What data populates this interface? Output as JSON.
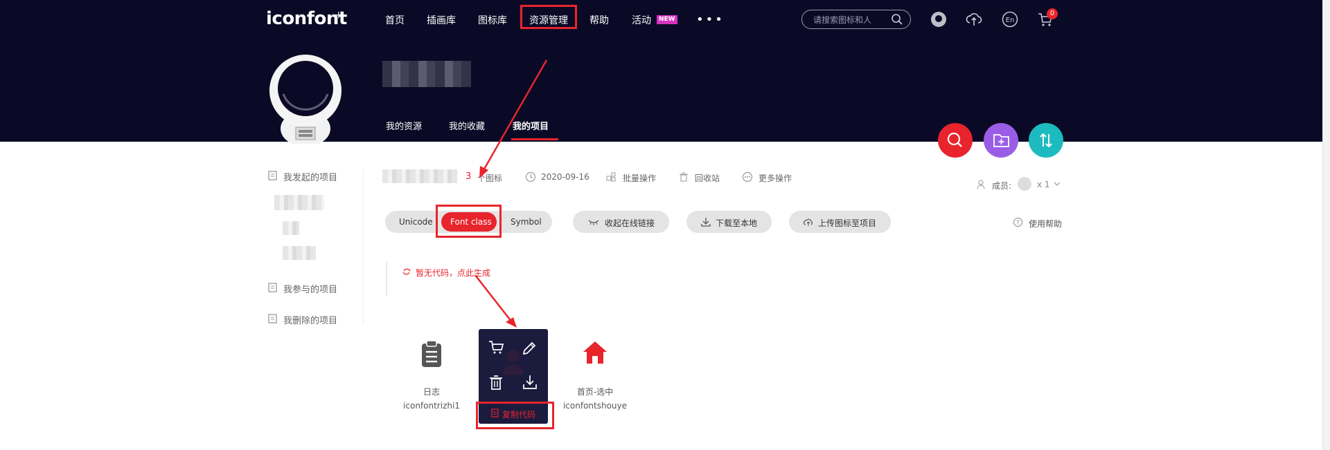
{
  "header": {
    "logo": "iconfont",
    "logo_mark": "+",
    "nav": [
      "首页",
      "插画库",
      "图标库",
      "资源管理",
      "帮助",
      "活动"
    ],
    "new_badge": "NEW",
    "more": "•••",
    "search_placeholder": "请搜索图标和人",
    "cart_count": "0",
    "lang": "En"
  },
  "profile": {
    "tabs": [
      "我的资源",
      "我的收藏",
      "我的项目"
    ],
    "active_tab_index": 2
  },
  "sidebar": {
    "items": [
      "我发起的项目",
      "我参与的项目",
      "我删除的项目"
    ]
  },
  "project": {
    "icon_count": "3",
    "icon_count_suffix": "个图标",
    "date": "2020-09-16",
    "actions": [
      "批量操作",
      "回收站",
      "更多操作"
    ],
    "members_label": "成员:",
    "members_count": "x 1"
  },
  "toolbar": {
    "tabs": [
      "Unicode",
      "Font class",
      "Symbol"
    ],
    "active_tab": "Font class",
    "buttons": [
      "收起在线链接",
      "下载至本地",
      "上传图标至项目"
    ],
    "help": "使用帮助"
  },
  "code_tip": "暂无代码，点此生成",
  "icons": [
    {
      "name": "日志",
      "code": "iconfontrizhi1",
      "icon": "clipboard-icon"
    },
    {
      "name": "",
      "code": "",
      "icon": "user-icon"
    },
    {
      "name": "首页-选中",
      "code": "iconfontshouye",
      "icon": "home-icon"
    }
  ],
  "hover_card": {
    "copy_label": "复制代码"
  },
  "colors": {
    "header_bg": "#0b0a26",
    "accent": "#e8242c",
    "fab_purple": "#9a5ee6",
    "fab_teal": "#1dbbc0",
    "card_bg": "#1b1b3e"
  }
}
